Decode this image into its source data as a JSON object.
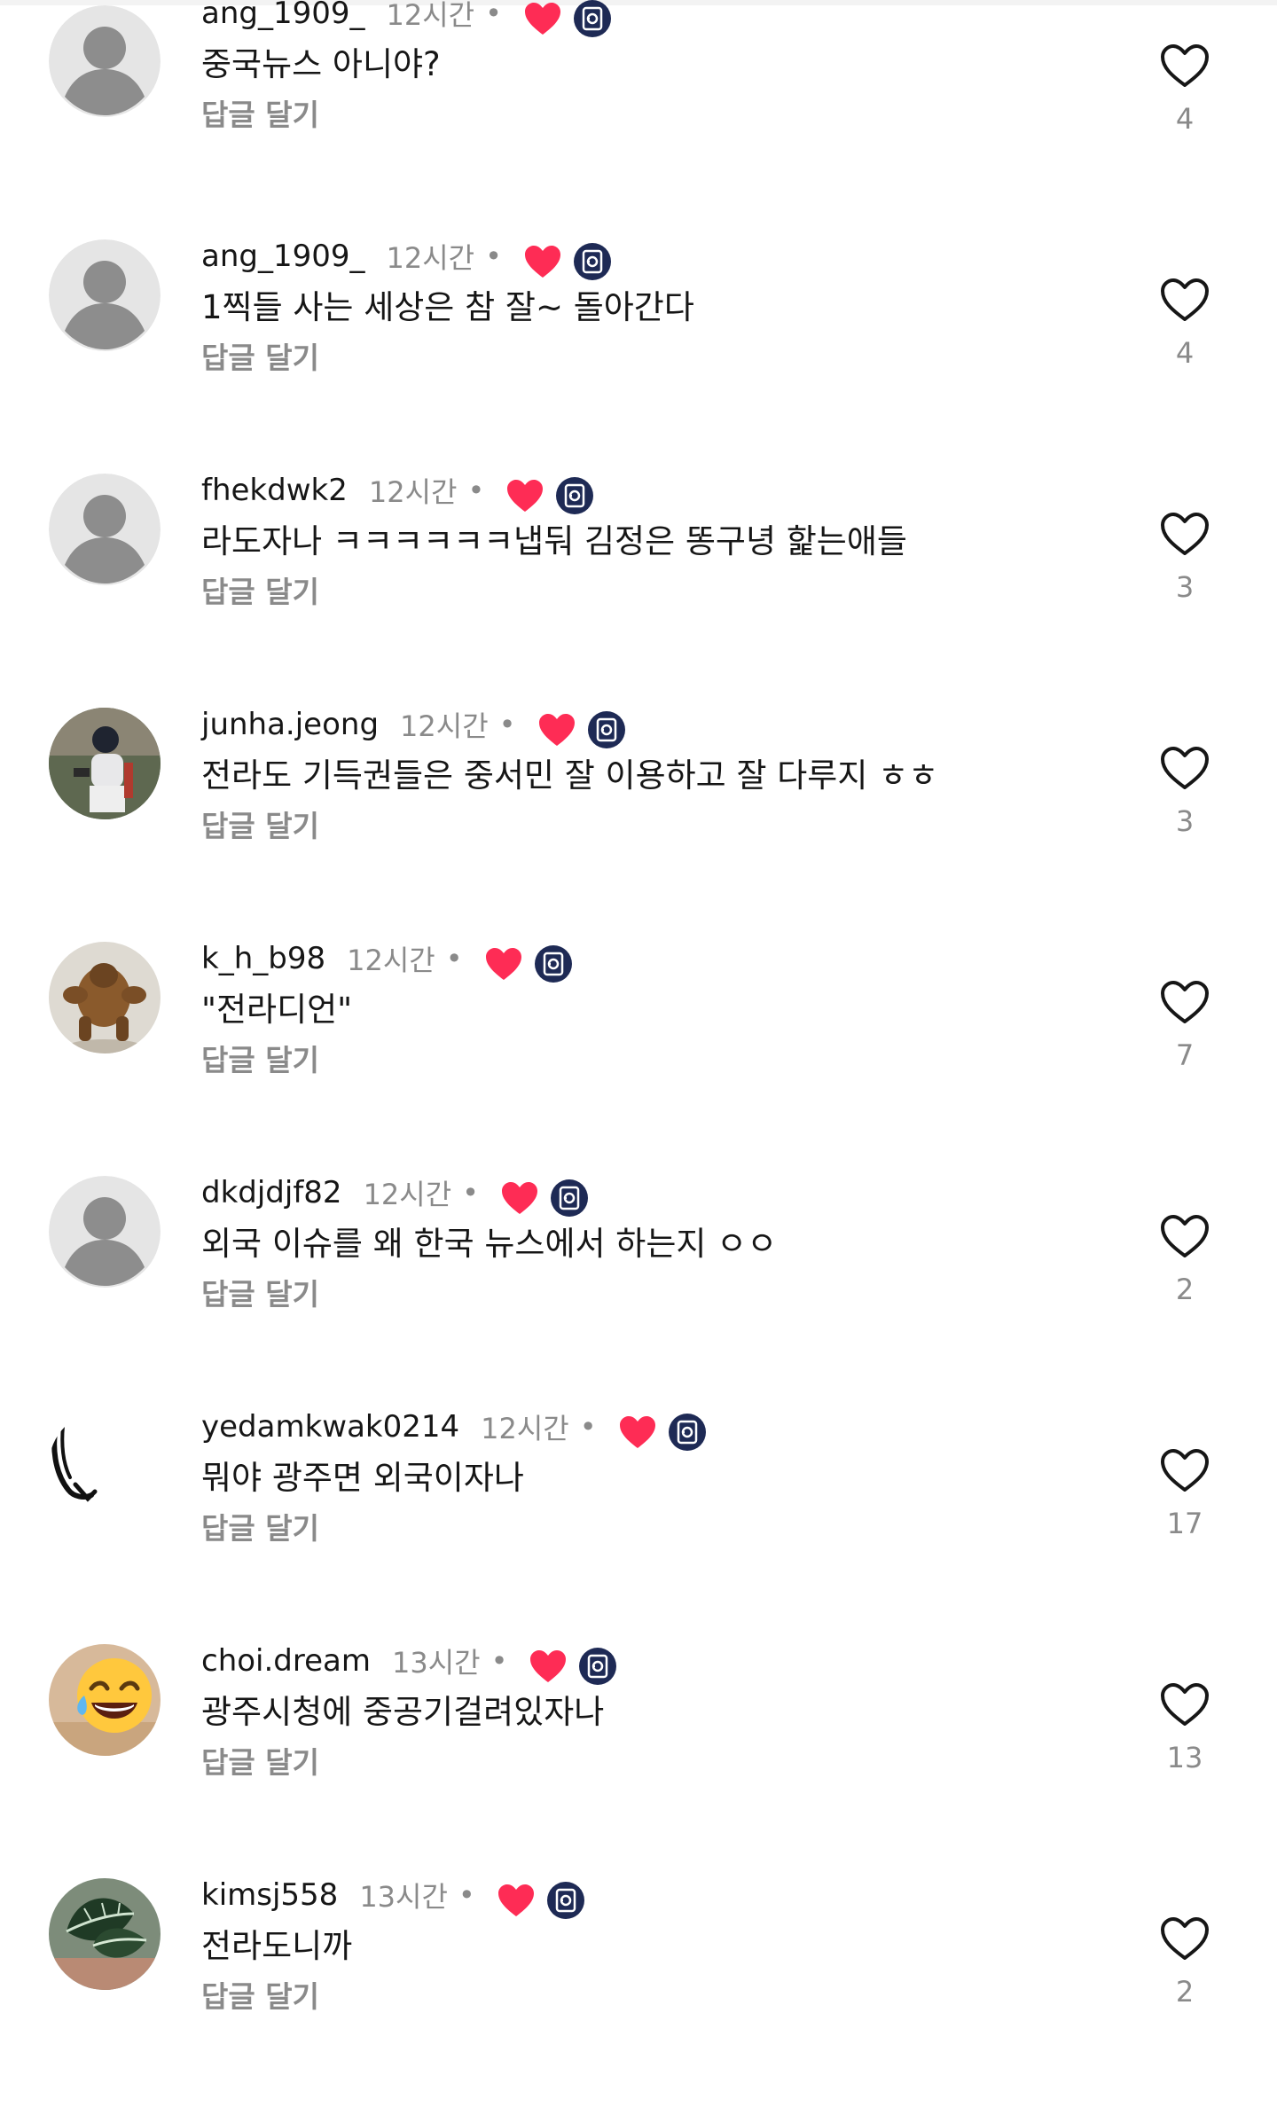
{
  "reply_label": "답글 달기",
  "colors": {
    "heart_red": "#fe2c55",
    "muted": "#8a8a8a",
    "text": "#161616",
    "badge_navy": "#1e2a55"
  },
  "comments": [
    {
      "username": "ang_1909_",
      "time": "12시간",
      "text": "중국뉴스 아니야?",
      "likes": "4",
      "avatar": "default-avatar"
    },
    {
      "username": "ang_1909_",
      "time": "12시간",
      "text": "1찍들 사는 세상은 참 잘~ 돌아간다",
      "likes": "4",
      "avatar": "default-avatar"
    },
    {
      "username": "fhekdwk2",
      "time": "12시간",
      "text": "라도자나 ㅋㅋㅋㅋㅋㅋ냅둬 김정은 똥구녕 핥는애들",
      "likes": "3",
      "avatar": "default-avatar"
    },
    {
      "username": "junha.jeong",
      "time": "12시간",
      "text": "전라도 기득권들은  중서민 잘 이용하고  잘 다루지 ㅎㅎ",
      "likes": "3",
      "avatar": "baseball-player-photo"
    },
    {
      "username": "k_h_b98",
      "time": "12시간",
      "text": "\"전라디언\"",
      "likes": "7",
      "avatar": "creature-figure-photo"
    },
    {
      "username": "dkdjdjf82",
      "time": "12시간",
      "text": "외국 이슈를 왜 한국 뉴스에서 하는지 ㅇㅇ",
      "likes": "2",
      "avatar": "default-avatar"
    },
    {
      "username": "yedamkwak0214",
      "time": "12시간",
      "text": "뭐야 광주면 외국이자나",
      "likes": "17",
      "avatar": "ink-sketch"
    },
    {
      "username": "choi.dream",
      "time": "13시간",
      "text": "광주시청에 중공기걸려있자나",
      "likes": "13",
      "avatar": "laughing-emoji"
    },
    {
      "username": "kimsj558",
      "time": "13시간",
      "text": "전라도니까",
      "likes": "2",
      "avatar": "plant-leaf-photo"
    }
  ]
}
